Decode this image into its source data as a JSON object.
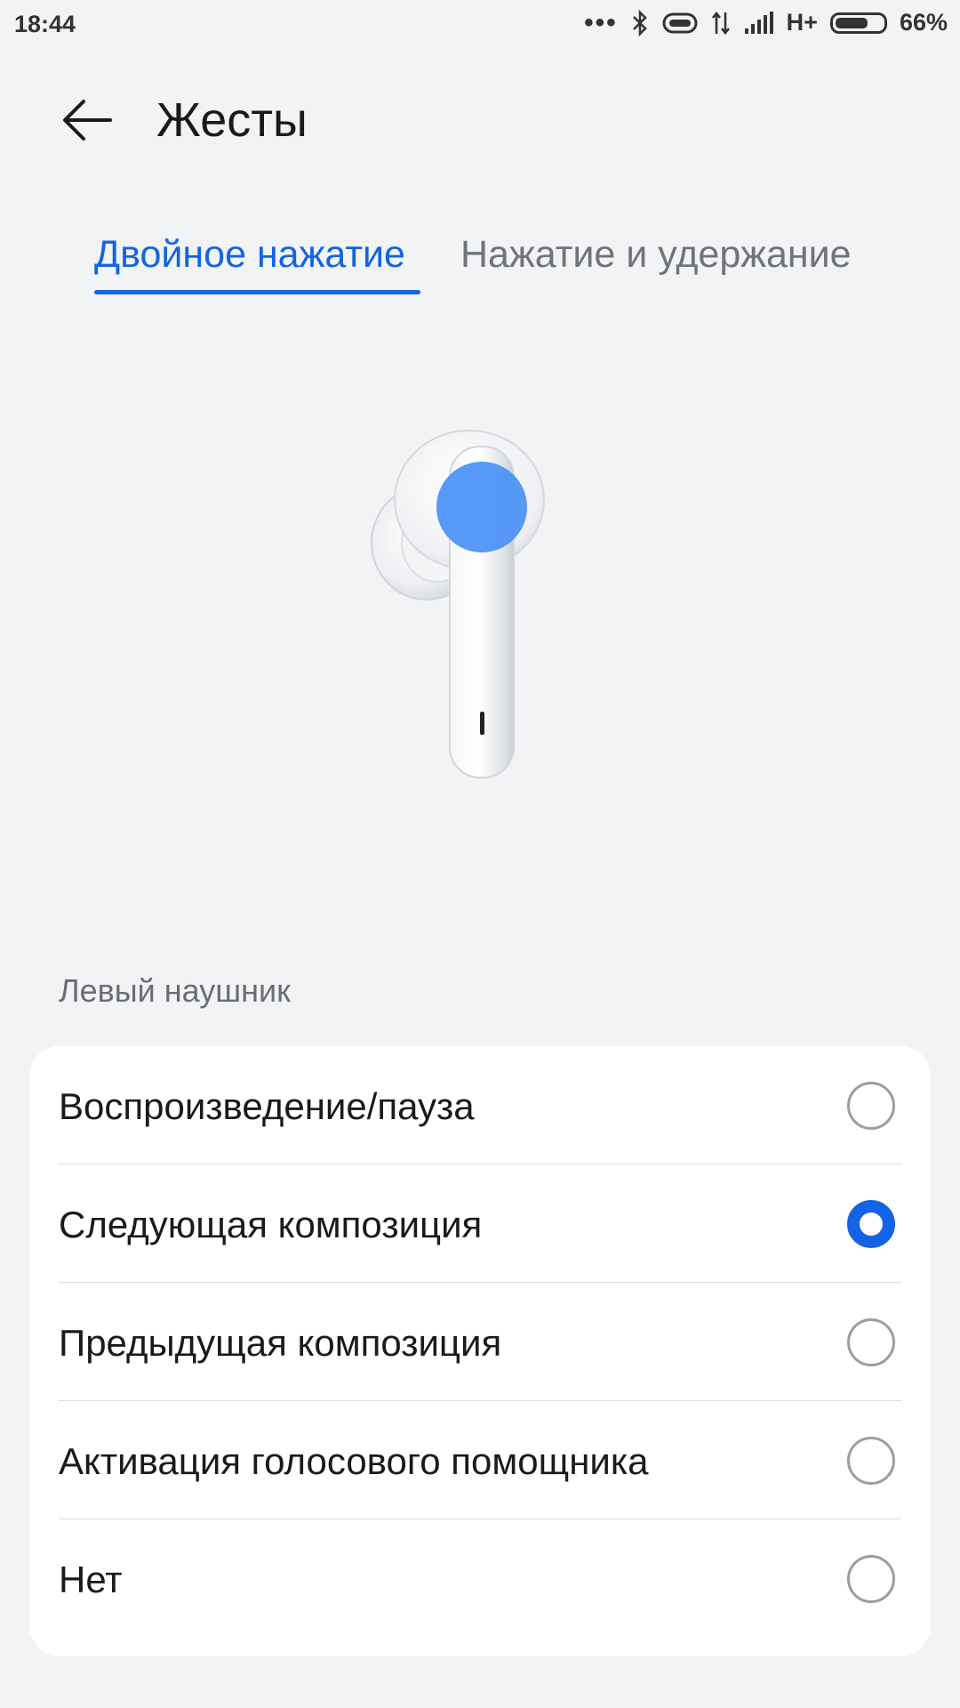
{
  "status_bar": {
    "time": "18:44",
    "network": "H+",
    "battery": "66%",
    "battery_level": 0.66,
    "icons": [
      "more-dots-icon",
      "bluetooth-icon",
      "link-icon",
      "data-transfer-icon",
      "signal-icon",
      "battery-icon"
    ]
  },
  "header": {
    "title": "Жесты",
    "back_icon": "back-arrow-icon"
  },
  "tabs": [
    {
      "label": "Двойное нажатие",
      "active": true
    },
    {
      "label": "Нажатие и удержание",
      "active": false
    }
  ],
  "illustration": {
    "subject": "earbud-icon",
    "highlight_color": "#4d94f5"
  },
  "section": {
    "label": "Левый наушник"
  },
  "options": [
    {
      "label": "Воспроизведение/пауза",
      "selected": false
    },
    {
      "label": "Следующая композиция",
      "selected": true
    },
    {
      "label": "Предыдущая композиция",
      "selected": false
    },
    {
      "label": "Активация голосового помощника",
      "selected": false
    },
    {
      "label": "Нет",
      "selected": false
    }
  ],
  "colors": {
    "accent": "#1463e6",
    "background": "#f1f3f5",
    "card": "#ffffff",
    "inactive_text": "#707378"
  }
}
